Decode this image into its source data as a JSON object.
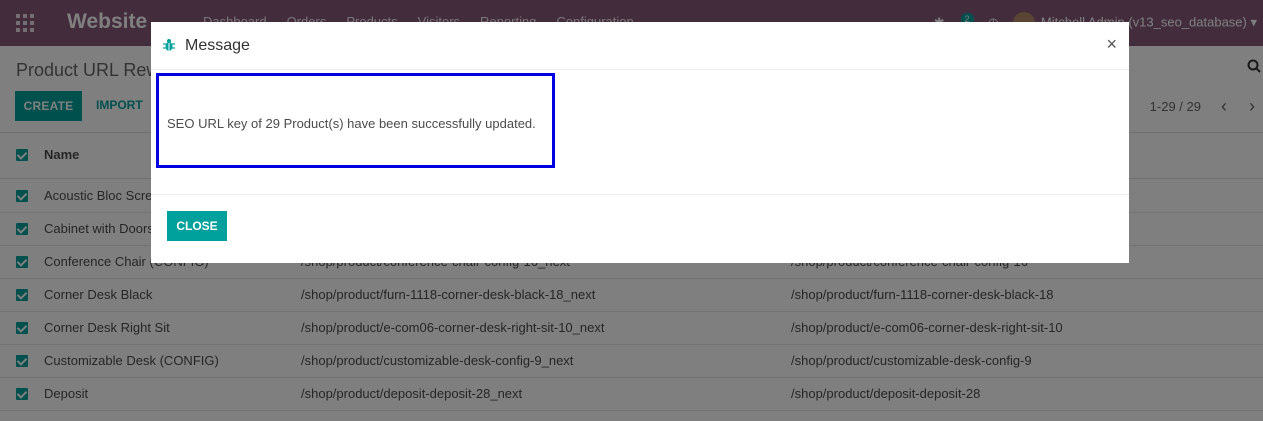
{
  "topbar": {
    "brand": "Website",
    "menu": [
      "Dashboard",
      "Orders",
      "Products",
      "Visitors",
      "Reporting",
      "Configuration"
    ],
    "chat_count": "2",
    "user": "Mitchell Admin (v13_seo_database)"
  },
  "control_panel": {
    "breadcrumb": "Product URL Rew",
    "create_label": "CREATE",
    "import_label": "IMPORT",
    "pager": "1-29 / 29"
  },
  "table": {
    "header_name": "Name",
    "rows": [
      {
        "name": "Acoustic Bloc Scre",
        "new_url": "",
        "old_url": ""
      },
      {
        "name": "Cabinet with Doors",
        "new_url": "",
        "old_url": ""
      },
      {
        "name": "Conference Chair (CONFIG)",
        "new_url": "/shop/product/conference-chair-config-16_next",
        "old_url": "/shop/product/conference-chair-config-16"
      },
      {
        "name": "Corner Desk Black",
        "new_url": "/shop/product/furn-1118-corner-desk-black-18_next",
        "old_url": "/shop/product/furn-1118-corner-desk-black-18"
      },
      {
        "name": "Corner Desk Right Sit",
        "new_url": "/shop/product/e-com06-corner-desk-right-sit-10_next",
        "old_url": "/shop/product/e-com06-corner-desk-right-sit-10"
      },
      {
        "name": "Customizable Desk (CONFIG)",
        "new_url": "/shop/product/customizable-desk-config-9_next",
        "old_url": "/shop/product/customizable-desk-config-9"
      },
      {
        "name": "Deposit",
        "new_url": "/shop/product/deposit-deposit-28_next",
        "old_url": "/shop/product/deposit-deposit-28"
      }
    ]
  },
  "modal": {
    "title": "Message",
    "close_x": "×",
    "message": "SEO URL key of 29 Product(s) have been successfully updated.",
    "close_label": "CLOSE"
  },
  "colors": {
    "brand": "#875a7b",
    "accent": "#00a09d",
    "highlight": "#0000e0"
  },
  "icons": [
    "apps-grid-icon",
    "bug-icon",
    "search-icon",
    "chevron-left-icon",
    "chevron-right-icon",
    "close-icon"
  ]
}
